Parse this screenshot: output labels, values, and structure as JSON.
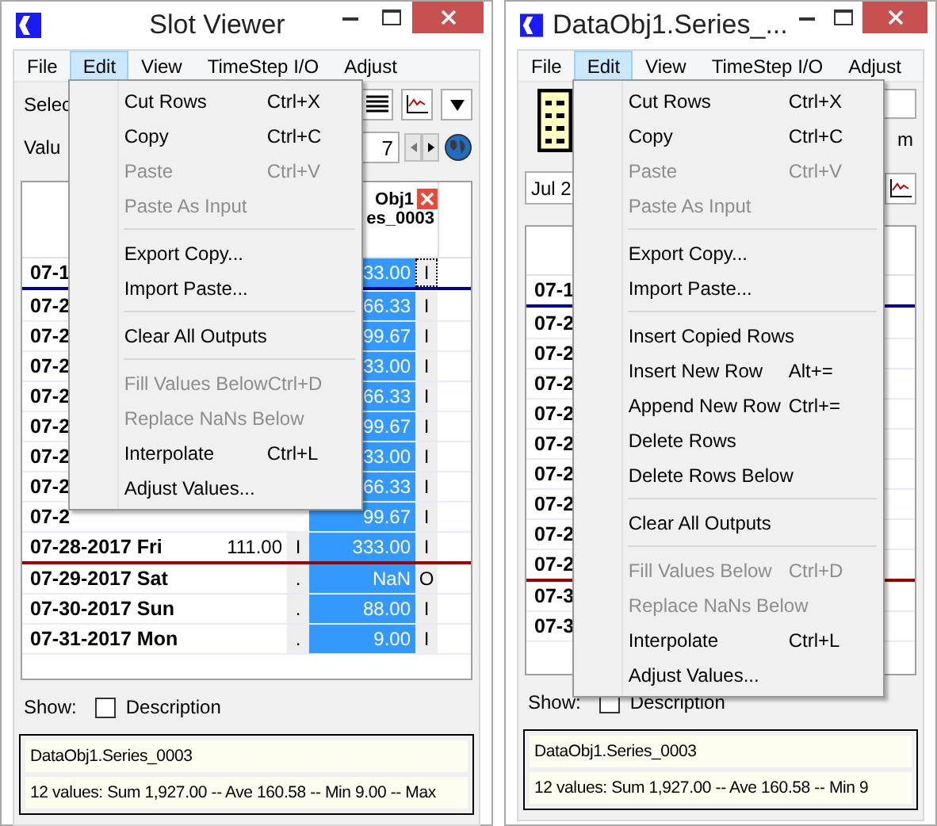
{
  "windows": [
    {
      "kind": "slot_viewer",
      "title": "Slot Viewer",
      "menus": [
        {
          "label": "File",
          "selected": false
        },
        {
          "label": "Edit",
          "selected": true
        },
        {
          "label": "View",
          "selected": false
        },
        {
          "label": "TimeStep I/O",
          "selected": false
        },
        {
          "label": "Adjust",
          "selected": false
        }
      ],
      "select_label": "Selec",
      "value_label": "Valu",
      "date_value": "7",
      "table": {
        "header_lines": [
          "Obj1",
          "es_0003"
        ],
        "rows": [
          {
            "date": "07-1",
            "col2": "",
            "col2_flag": "",
            "value": "33.00",
            "flag": "I",
            "focused": true,
            "start_marker": true
          },
          {
            "date": "07-2",
            "col2": "",
            "col2_flag": "",
            "value": "66.33",
            "flag": "I",
            "focused": false
          },
          {
            "date": "07-2",
            "col2": "",
            "col2_flag": "",
            "value": "99.67",
            "flag": "I",
            "focused": false
          },
          {
            "date": "07-2",
            "col2": "",
            "col2_flag": "",
            "value": "33.00",
            "flag": "I",
            "focused": false
          },
          {
            "date": "07-2",
            "col2": "",
            "col2_flag": "",
            "value": "66.33",
            "flag": "I",
            "focused": false
          },
          {
            "date": "07-2",
            "col2": "",
            "col2_flag": "",
            "value": "99.67",
            "flag": "I",
            "focused": false
          },
          {
            "date": "07-2",
            "col2": "",
            "col2_flag": "",
            "value": "33.00",
            "flag": "I",
            "focused": false
          },
          {
            "date": "07-2",
            "col2": "",
            "col2_flag": "",
            "value": "66.33",
            "flag": "I",
            "focused": false
          },
          {
            "date": "07-2",
            "col2": "",
            "col2_flag": "",
            "value": "99.67",
            "flag": "I",
            "focused": false
          },
          {
            "date": "07-28-2017 Fri",
            "col2": "111.00",
            "col2_flag": "I",
            "value": "333.00",
            "flag": "I",
            "focused": false,
            "end_marker": true
          },
          {
            "date": "07-29-2017 Sat",
            "col2": "",
            "col2_flag": ".",
            "value": "NaN",
            "flag": "O",
            "focused": false
          },
          {
            "date": "07-30-2017 Sun",
            "col2": "",
            "col2_flag": ".",
            "value": "88.00",
            "flag": "I",
            "focused": false
          },
          {
            "date": "07-31-2017 Mon",
            "col2": "",
            "col2_flag": ".",
            "value": "9.00",
            "flag": "I",
            "focused": false
          }
        ]
      },
      "show_label": "Show:",
      "description": {
        "label": "Description",
        "checked": false
      },
      "status": [
        "DataObj1.Series_0003",
        "12 values:  Sum 1,927.00 -- Ave 160.58 -- Min 9.00 -- Max"
      ],
      "menu_items": [
        {
          "kind": "item",
          "label": "Cut Rows",
          "shortcut": "Ctrl+X",
          "disabled": false
        },
        {
          "kind": "item",
          "label": "Copy",
          "shortcut": "Ctrl+C",
          "disabled": false
        },
        {
          "kind": "item",
          "label": "Paste",
          "shortcut": "Ctrl+V",
          "disabled": true
        },
        {
          "kind": "item",
          "label": "Paste As Input",
          "disabled": true
        },
        {
          "kind": "separator"
        },
        {
          "kind": "item",
          "label": "Export Copy...",
          "disabled": false
        },
        {
          "kind": "item",
          "label": "Import Paste...",
          "disabled": false
        },
        {
          "kind": "separator"
        },
        {
          "kind": "item",
          "label": "Clear All Outputs",
          "disabled": false
        },
        {
          "kind": "separator"
        },
        {
          "kind": "item",
          "label": "Fill Values Below",
          "shortcut": "Ctrl+D",
          "disabled": true
        },
        {
          "kind": "item",
          "label": "Replace NaNs Below",
          "disabled": true
        },
        {
          "kind": "item",
          "label": "Interpolate",
          "shortcut": "Ctrl+L",
          "disabled": false
        },
        {
          "kind": "item",
          "label": "Adjust Values...",
          "disabled": false
        }
      ]
    },
    {
      "kind": "series",
      "title": "DataObj1.Series_...",
      "menus": [
        {
          "label": "File",
          "selected": false
        },
        {
          "label": "Edit",
          "selected": true
        },
        {
          "label": "View",
          "selected": false
        },
        {
          "label": "TimeStep I/O",
          "selected": false
        },
        {
          "label": "Adjust",
          "selected": false
        }
      ],
      "unit_label": "m",
      "date_value": "Jul 2",
      "table": {
        "rows": [
          {
            "date": "07-1",
            "start_marker": true
          },
          {
            "date": "07-2"
          },
          {
            "date": "07-2"
          },
          {
            "date": "07-2"
          },
          {
            "date": "07-2"
          },
          {
            "date": "07-2"
          },
          {
            "date": "07-2"
          },
          {
            "date": "07-2"
          },
          {
            "date": "07-2"
          },
          {
            "date": "07-2",
            "end_marker": true
          },
          {
            "date": "07-3"
          },
          {
            "date": "07-3"
          }
        ]
      },
      "show_label": "Show:",
      "description": {
        "label": "Description",
        "checked": false
      },
      "status": [
        "DataObj1.Series_0003",
        "12 values:  Sum 1,927.00 -- Ave 160.58 -- Min 9"
      ],
      "menu_items": [
        {
          "kind": "item",
          "label": "Cut Rows",
          "shortcut": "Ctrl+X",
          "disabled": false
        },
        {
          "kind": "item",
          "label": "Copy",
          "shortcut": "Ctrl+C",
          "disabled": false
        },
        {
          "kind": "item",
          "label": "Paste",
          "shortcut": "Ctrl+V",
          "disabled": true
        },
        {
          "kind": "item",
          "label": "Paste As Input",
          "disabled": true
        },
        {
          "kind": "separator"
        },
        {
          "kind": "item",
          "label": "Export Copy...",
          "disabled": false
        },
        {
          "kind": "item",
          "label": "Import Paste...",
          "disabled": false
        },
        {
          "kind": "separator"
        },
        {
          "kind": "item",
          "label": "Insert Copied Rows",
          "disabled": false
        },
        {
          "kind": "item",
          "label": "Insert New Row",
          "shortcut": "Alt+=",
          "disabled": false
        },
        {
          "kind": "item",
          "label": "Append New Row",
          "shortcut": "Ctrl+=",
          "disabled": false
        },
        {
          "kind": "item",
          "label": "Delete Rows",
          "disabled": false
        },
        {
          "kind": "item",
          "label": "Delete Rows Below",
          "disabled": false
        },
        {
          "kind": "separator"
        },
        {
          "kind": "item",
          "label": "Clear All Outputs",
          "disabled": false
        },
        {
          "kind": "separator"
        },
        {
          "kind": "item",
          "label": "Fill Values Below",
          "shortcut": "Ctrl+D",
          "disabled": true
        },
        {
          "kind": "item",
          "label": "Replace NaNs Below",
          "disabled": true
        },
        {
          "kind": "item",
          "label": "Interpolate",
          "shortcut": "Ctrl+L",
          "disabled": false
        },
        {
          "kind": "item",
          "label": "Adjust Values...",
          "disabled": false
        }
      ]
    }
  ]
}
